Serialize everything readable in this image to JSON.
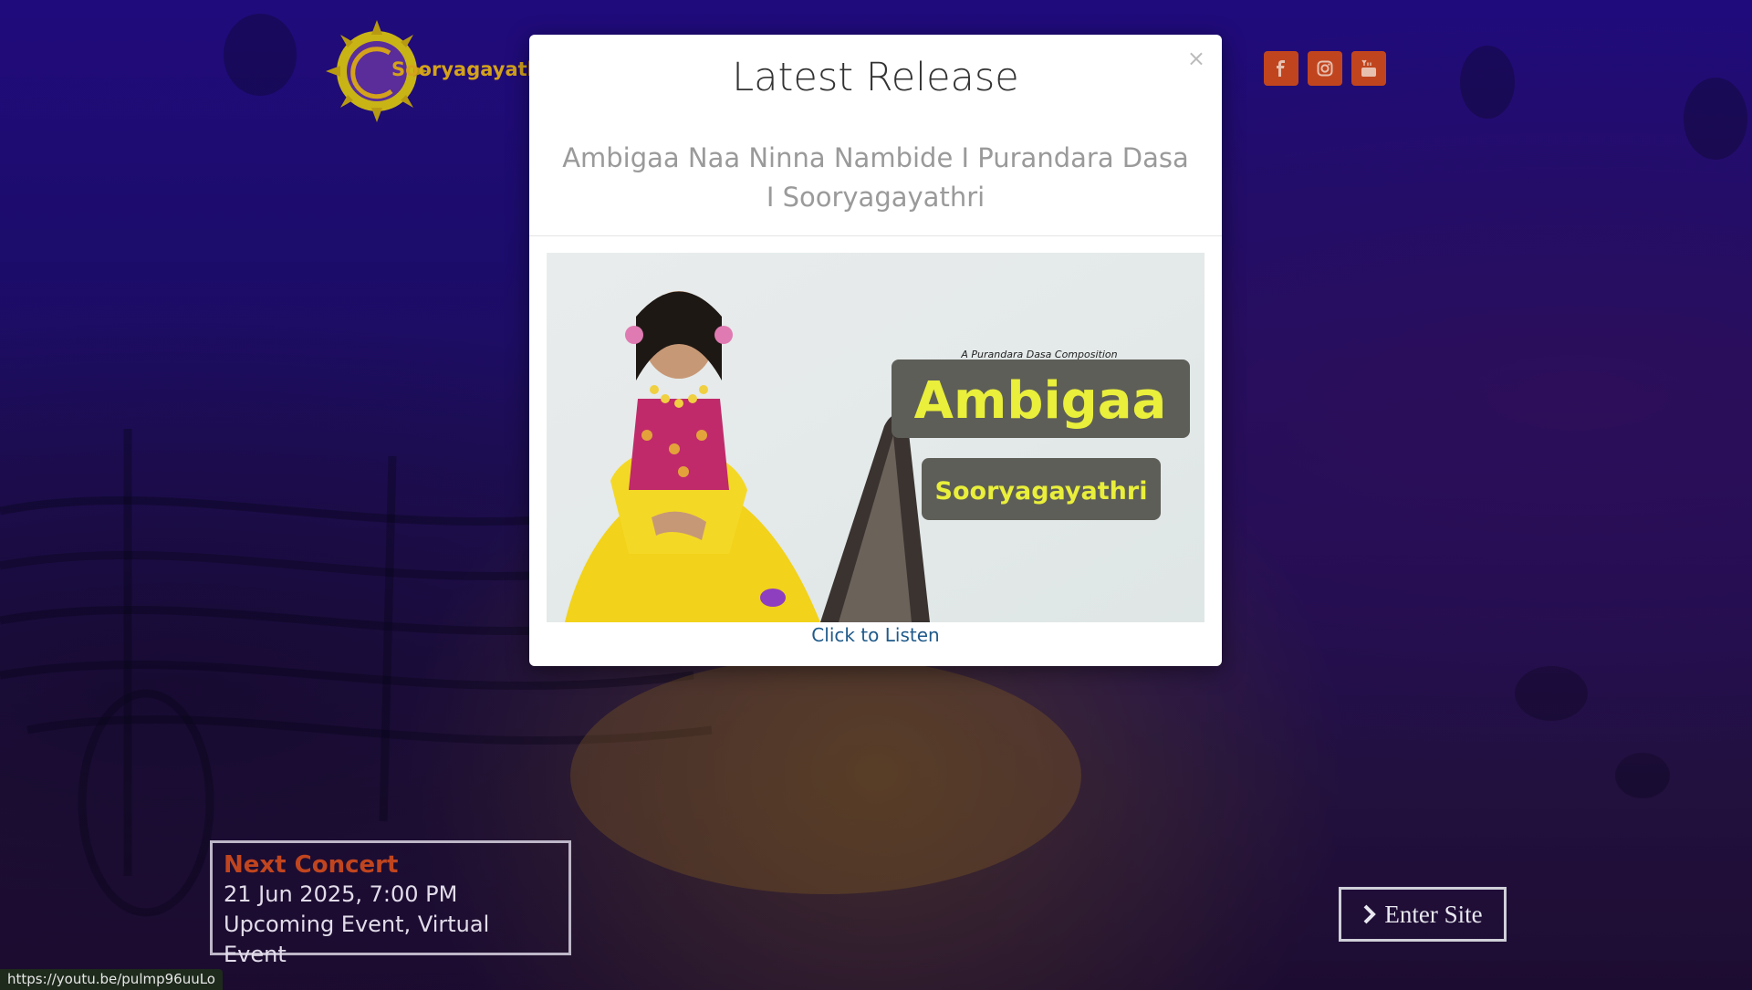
{
  "site": {
    "logo_text": "Sooryagayathri"
  },
  "socials": [
    {
      "name": "facebook",
      "icon": "facebook-icon"
    },
    {
      "name": "instagram",
      "icon": "instagram-icon"
    },
    {
      "name": "youtube",
      "icon": "youtube-icon"
    }
  ],
  "modal": {
    "title": "Latest Release",
    "subtitle": "Ambigaa Naa Ninna Nambide I Purandara Dasa I Sooryagayathri",
    "close_label": "×",
    "thumbnail": {
      "tagline": "A Purandara Dasa Composition",
      "title": "Ambigaa",
      "artist": "Sooryagayathri"
    },
    "listen_label": "Click to Listen"
  },
  "concert": {
    "heading": "Next Concert",
    "date": "21 Jun 2025, 7:00 PM",
    "type": "Upcoming Event, Virtual Event"
  },
  "enter": {
    "label": "Enter Site"
  },
  "status_bar": {
    "url": "https://youtu.be/pulmp96uuLo"
  },
  "colors": {
    "accent": "#c0451e",
    "link": "#1f5a8a",
    "badge_yellow": "#e9ef3a"
  }
}
